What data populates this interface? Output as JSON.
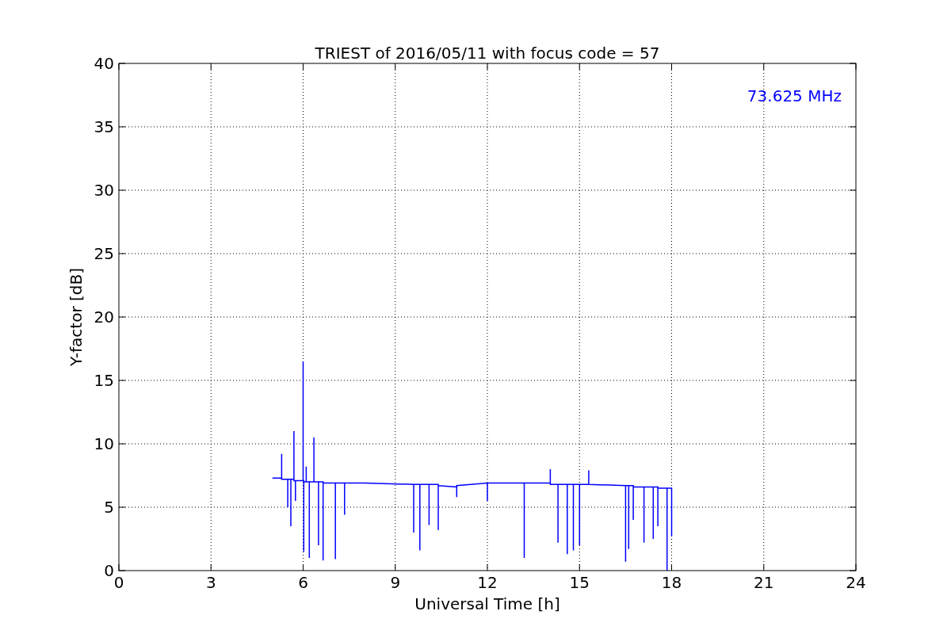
{
  "chart_data": {
    "type": "line",
    "title": "TRIEST of 2016/05/11 with focus code = 57",
    "xlabel": "Universal Time [h]",
    "ylabel": "Y-factor [dB]",
    "xlim": [
      0,
      24
    ],
    "ylim": [
      0,
      40
    ],
    "grid": true,
    "xticks": [
      0,
      3,
      6,
      9,
      12,
      15,
      18,
      21,
      24
    ],
    "yticks": [
      0,
      5,
      10,
      15,
      20,
      25,
      30,
      35,
      40
    ],
    "x": [
      5.0,
      5.3,
      5.3,
      5.3,
      5.5,
      5.5,
      5.5,
      5.6,
      5.6,
      5.6,
      5.7,
      5.7,
      5.7,
      5.75,
      5.75,
      5.75,
      6.0,
      6.0,
      6.0,
      6.02,
      6.02,
      6.02,
      6.1,
      6.1,
      6.1,
      6.2,
      6.2,
      6.2,
      6.35,
      6.35,
      6.35,
      6.5,
      6.5,
      6.5,
      6.65,
      6.65,
      6.65,
      7.05,
      7.05,
      7.05,
      7.35,
      7.35,
      7.35,
      8.0,
      9.6,
      9.6,
      9.6,
      9.8,
      9.8,
      9.8,
      10.1,
      10.1,
      10.1,
      10.4,
      10.4,
      10.4,
      11.0,
      11.0,
      11.0,
      12.0,
      12.0,
      12.0,
      13.2,
      13.2,
      13.2,
      14.05,
      14.05,
      14.05,
      14.3,
      14.3,
      14.3,
      14.6,
      14.6,
      14.6,
      14.8,
      14.8,
      14.8,
      15.0,
      15.0,
      15.0,
      15.3,
      15.3,
      15.3,
      16.5,
      16.5,
      16.5,
      16.6,
      16.6,
      16.6,
      16.75,
      16.75,
      16.75,
      17.1,
      17.1,
      17.1,
      17.4,
      17.4,
      17.4,
      17.55,
      17.55,
      17.55,
      17.85,
      17.85,
      17.85,
      18.0,
      18.0
    ],
    "series": [
      {
        "name": "73.625 MHz",
        "color": "#0000ff",
        "values": [
          7.3,
          7.3,
          9.2,
          7.2,
          7.2,
          5.0,
          7.2,
          7.2,
          3.5,
          7.2,
          7.2,
          11.0,
          7.1,
          7.1,
          5.5,
          7.1,
          7.1,
          16.5,
          7.1,
          7.1,
          1.5,
          7.0,
          7.0,
          8.2,
          7.0,
          7.0,
          1.0,
          7.0,
          7.0,
          10.5,
          7.0,
          7.0,
          2.0,
          7.0,
          7.0,
          0.8,
          6.9,
          6.9,
          0.9,
          6.9,
          6.9,
          4.4,
          6.9,
          6.9,
          6.8,
          3.0,
          6.8,
          6.8,
          1.6,
          6.8,
          6.8,
          3.6,
          6.8,
          6.8,
          3.2,
          6.7,
          6.6,
          5.8,
          6.7,
          6.9,
          5.5,
          6.9,
          6.9,
          1.0,
          6.9,
          6.9,
          8.0,
          6.8,
          6.8,
          2.2,
          6.8,
          6.8,
          1.3,
          6.8,
          6.8,
          1.6,
          6.8,
          6.8,
          2.0,
          6.8,
          6.8,
          7.9,
          6.8,
          6.7,
          0.7,
          6.7,
          6.7,
          1.7,
          6.7,
          6.7,
          4.0,
          6.6,
          6.6,
          2.2,
          6.6,
          6.6,
          2.5,
          6.6,
          6.6,
          3.5,
          6.5,
          6.5,
          0.0,
          6.5,
          6.5,
          2.7
        ]
      }
    ]
  }
}
